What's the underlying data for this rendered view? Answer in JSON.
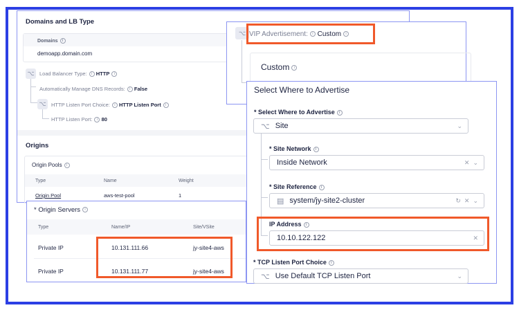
{
  "domains_panel": {
    "title": "Domains and LB Type",
    "domains_label": "Domains",
    "domain_value": "demoapp.domain.com",
    "lb_type_label": "Load Balancer Type:",
    "lb_type_value": "HTTP",
    "dns_label": "Automatically Manage DNS Records:",
    "dns_value": "False",
    "port_choice_label": "HTTP Listen Port Choice:",
    "port_choice_value": "HTTP Listen Port",
    "port_label": "HTTP Listen Port:",
    "port_value": "80",
    "origins_title": "Origins",
    "origin_pools_label": "Origin Pools",
    "pool_headers": [
      "Type",
      "Name",
      "Weight"
    ],
    "pool_row": [
      "Origin Pool",
      "aws-test-pool",
      "1"
    ]
  },
  "vip_panel": {
    "label": "VIP Advertisement:",
    "value": "Custom",
    "custom_title": "Custom"
  },
  "advertise_panel": {
    "title": "Select Where to Advertise",
    "where_label": "* Select Where to Advertise",
    "where_value": "Site",
    "network_label": "* Site Network",
    "network_value": "Inside Network",
    "ref_label": "* Site Reference",
    "ref_value": "system/jy-site2-cluster",
    "ip_label": "IP Address",
    "ip_value": "10.10.122.122",
    "tcp_label": "* TCP Listen Port Choice",
    "tcp_value": "Use Default TCP Listen Port"
  },
  "origin_servers": {
    "title": "* Origin Servers",
    "headers": [
      "Type",
      "Name/IP",
      "Site/VSite"
    ],
    "rows": [
      [
        "Private IP",
        "10.131.111.66",
        "jy-site4-aws"
      ],
      [
        "Private IP",
        "10.131.111.77",
        "jy-site4-aws"
      ]
    ]
  },
  "colors": {
    "frame": "#2c3fe4",
    "highlight": "#f0592a",
    "panel_border": "#8c95f2"
  }
}
